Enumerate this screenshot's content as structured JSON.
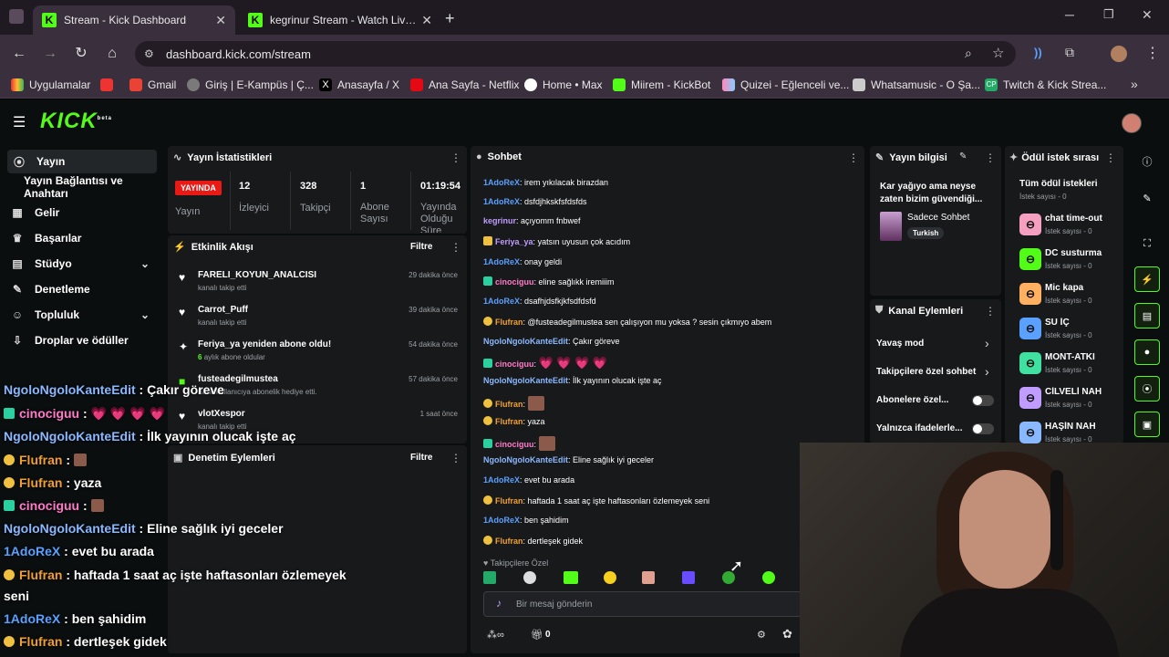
{
  "browser": {
    "tabs": [
      {
        "title": "Stream - Kick Dashboard",
        "active": true
      },
      {
        "title": "kegrinur Stream - Watch Live o",
        "active": false
      }
    ],
    "new_tab": "+",
    "url": "dashboard.kick.com/stream",
    "bookmarks": [
      "Uygulamalar",
      "Gmail",
      "Giriş | E-Kampüs | Ç...",
      "Anasayfa / X",
      "Ana Sayfa - Netflix",
      "Home • Max",
      "Miirem - KickBot",
      "Quizei - Eğlenceli ve...",
      "Whatsamusic - O Şa...",
      "Twitch & Kick Strea..."
    ],
    "bookmark_colors": [
      "#e33",
      "#ea4335",
      "#7a7a7a",
      "#000",
      "#e50914",
      "#fff",
      "#53fc18",
      "#f8b",
      "#ccc",
      "#2a6"
    ]
  },
  "app": {
    "logo": "KICK",
    "logo_sup": "beta"
  },
  "sidebar": {
    "items": [
      "Yayın",
      "Yayın Bağlantısı ve Anahtarı",
      "Gelir",
      "Başarılar",
      "Stüdyo",
      "Denetleme",
      "Topluluk",
      "Droplar ve ödüller"
    ]
  },
  "stats": {
    "title": "Yayın İstatistikleri",
    "live_badge": "YAYINDA",
    "live_label": "Yayın",
    "items": [
      {
        "value": "12",
        "label": "İzleyici"
      },
      {
        "value": "328",
        "label": "Takipçi"
      },
      {
        "value": "1",
        "label": "Abone Sayısı"
      },
      {
        "value": "01:19:54",
        "label": "Yayında Olduğu Süre"
      }
    ]
  },
  "activity": {
    "title": "Etkinlik Akışı",
    "filter": "Filtre",
    "items": [
      {
        "name": "FARELI_KOYUN_ANALCISI",
        "sub": "kanalı takip etti",
        "time": "29 dakika önce"
      },
      {
        "name": "Carrot_Puff",
        "sub": "kanalı takip etti",
        "time": "39 dakika önce"
      },
      {
        "name": "Feriya_ya yeniden abone oldu!",
        "sub_num": "6",
        "sub": "aylık abone oldular",
        "time": "54 dakika önce"
      },
      {
        "name": "fusteadegilmustea",
        "sub": "isimli kullanıcıya abonelik hediye etti.",
        "time": "57 dakika önce"
      },
      {
        "name": "vlotXespor",
        "sub": "kanalı takip etti",
        "time": "1 saat önce"
      }
    ]
  },
  "moderation": {
    "title": "Denetim Eylemleri",
    "filter": "Filtre"
  },
  "chat": {
    "title": "Sohbet",
    "messages": [
      {
        "user": "1AdoReX",
        "color": "#5aa0ff",
        "text": "irem yıkılacak birazdan"
      },
      {
        "user": "1AdoReX",
        "color": "#5aa0ff",
        "text": "dsfdjhkskfsfdsfds"
      },
      {
        "user": "kegrinur",
        "color": "#c09cff",
        "text": "açıyomm fnbwef"
      },
      {
        "user": "Feriya_ya",
        "color": "#c09cff",
        "text": "yatsın uyusun çok acıdım"
      },
      {
        "user": "1AdoReX",
        "color": "#5aa0ff",
        "text": "onay geldi"
      },
      {
        "user": "cinociguu",
        "color": "#ff7ac8",
        "text": "eline sağlıkk iremiiim"
      },
      {
        "user": "1AdoReX",
        "color": "#5aa0ff",
        "text": "dsafhjdsfkjkfsdfdsfd"
      },
      {
        "user": "Flufran",
        "color": "#f0a030",
        "text": "@fusteadegilmustea sen çalışıyon mu yoksa ? sesin çıkmıyo abem"
      },
      {
        "user": "NgoloNgoloKanteEdit",
        "color": "#8ab8ff",
        "text": "Çakır göreve"
      },
      {
        "user": "cinociguu",
        "color": "#ff7ac8",
        "text": "💗 💗 💗 💗"
      },
      {
        "user": "NgoloNgoloKanteEdit",
        "color": "#8ab8ff",
        "text": "İlk yayının olucak işte aç"
      },
      {
        "user": "Flufran",
        "color": "#f0a030",
        "text": ""
      },
      {
        "user": "Flufran",
        "color": "#f0a030",
        "text": "yaza"
      },
      {
        "user": "cinociguu",
        "color": "#ff7ac8",
        "text": ""
      },
      {
        "user": "NgoloNgoloKanteEdit",
        "color": "#8ab8ff",
        "text": "Eline sağlık iyi geceler"
      },
      {
        "user": "1AdoReX",
        "color": "#5aa0ff",
        "text": "evet bu arada"
      },
      {
        "user": "Flufran",
        "color": "#f0a030",
        "text": "haftada 1 saat aç işte haftasonları özlemeyek seni"
      },
      {
        "user": "1AdoReX",
        "color": "#5aa0ff",
        "text": "ben şahidim"
      },
      {
        "user": "Flufran",
        "color": "#f0a030",
        "text": "dertleşek gidek"
      }
    ],
    "followers_only": "Takipçilere Özel",
    "input_placeholder": "Bir mesaj gönderin",
    "points": "0"
  },
  "stream_info": {
    "title": "Yayın bilgisi",
    "stream_title": "Kar yağıyo ama neyse zaten bizim güvendiği...",
    "category": "Sadece Sohbet",
    "tag": "Turkish"
  },
  "channel_actions": {
    "title": "Kanal Eylemleri",
    "items": [
      "Yavaş mod",
      "Takipçilere özel sohbet",
      "Abonelere özel...",
      "Yalnızca ifadelerle..."
    ]
  },
  "rewards": {
    "title": "Ödül istek sırası",
    "subtitle": "Tüm ödül istekleri",
    "count_label": "İstek sayısı - 0",
    "items": [
      {
        "name": "chat time-out",
        "color": "#f5a0c0"
      },
      {
        "name": "DC susturma",
        "color": "#53fc18"
      },
      {
        "name": "Mic kapa",
        "color": "#ffb060"
      },
      {
        "name": "SU İÇ",
        "color": "#5aa0ff"
      },
      {
        "name": "MONT-ATKI",
        "color": "#40e0a0"
      },
      {
        "name": "CİLVELİ NAH",
        "color": "#c09cff"
      },
      {
        "name": "HAŞİN NAH",
        "color": "#8ab8ff"
      }
    ]
  },
  "overlay": {
    "messages": [
      {
        "user": "NgoloNgoloKanteEdit",
        "color": "#8ab8ff",
        "text": "Çakır göreve"
      },
      {
        "user": "cinociguu",
        "color": "#ff7ac8",
        "text": "💗 💗 💗 💗"
      },
      {
        "user": "NgoloNgoloKanteEdit",
        "color": "#8ab8ff",
        "text": "İlk yayının olucak işte aç"
      },
      {
        "user": "Flufran",
        "color": "#f0a030",
        "text": ""
      },
      {
        "user": "Flufran",
        "color": "#f0a030",
        "text": "yaza"
      },
      {
        "user": "cinociguu",
        "color": "#ff7ac8",
        "text": ""
      },
      {
        "user": "NgoloNgoloKanteEdit",
        "color": "#8ab8ff",
        "text": "Eline sağlık iyi geceler"
      },
      {
        "user": "1AdoReX",
        "color": "#5aa0ff",
        "text": "evet bu arada"
      },
      {
        "user": "Flufran",
        "color": "#f0a030",
        "text": "haftada 1 saat aç işte haftasonları özlemeyek"
      },
      {
        "user": "",
        "color": "#fff",
        "text": "seni"
      },
      {
        "user": "1AdoReX",
        "color": "#5aa0ff",
        "text": "ben şahidim"
      },
      {
        "user": "Flufran",
        "color": "#f0a030",
        "text": "dertleşek gidek"
      }
    ]
  }
}
